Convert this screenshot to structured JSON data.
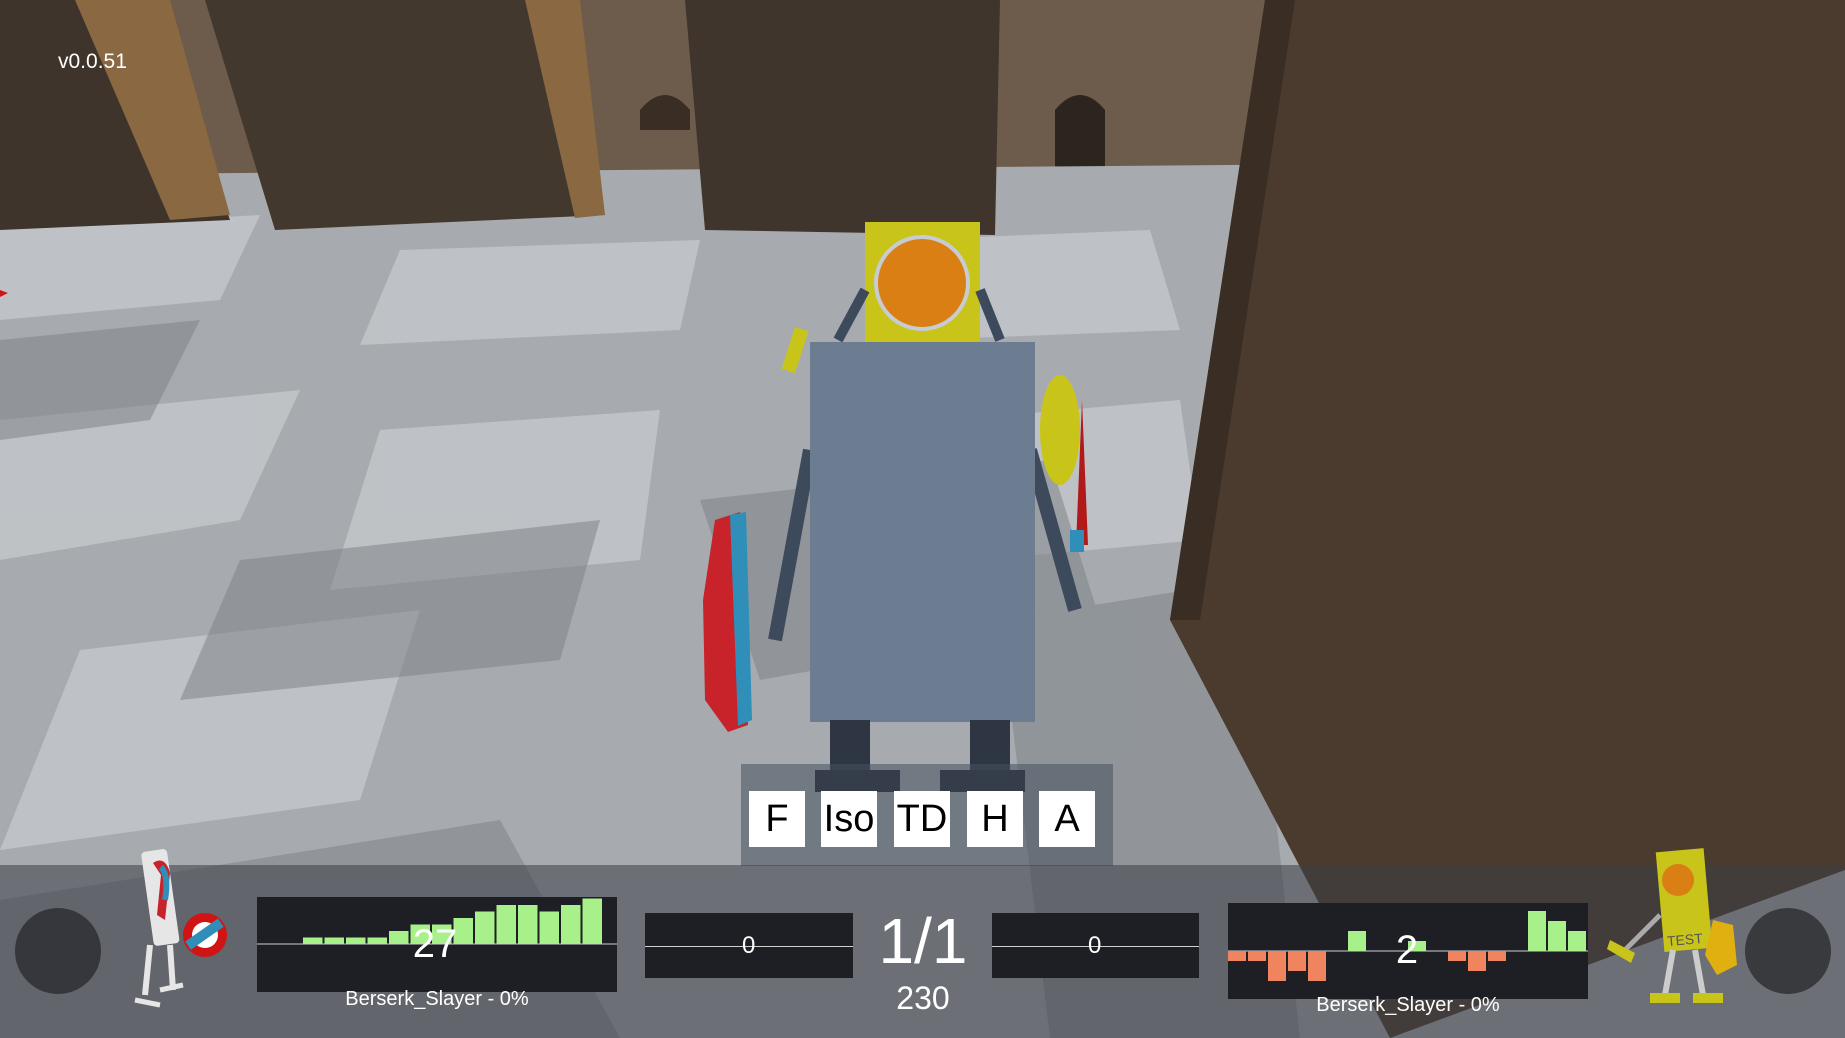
{
  "version": "v0.0.51",
  "camera_buttons": [
    "F",
    "Iso",
    "TD",
    "H",
    "A"
  ],
  "round": "1/1",
  "timer": "230",
  "left_player": {
    "name_label": "Berserk_Slayer - 0%",
    "score": "27",
    "graph_values": [
      0,
      0,
      1,
      1,
      1,
      1,
      2,
      3,
      3,
      4,
      5,
      6,
      6,
      5,
      6,
      7
    ]
  },
  "right_player": {
    "name_label": "Berserk_Slayer - 0%",
    "score": "2",
    "graph_values": [
      -1,
      -1,
      -3,
      -2,
      -3,
      0,
      2,
      0,
      0,
      1,
      0,
      -1,
      -2,
      -1,
      0,
      4,
      3,
      2
    ]
  },
  "left_mid_value": "0",
  "right_mid_value": "0",
  "colors": {
    "graph_positive": "#a8f08a",
    "graph_negative": "#f0845e",
    "robot_yellow": "#c8c41a",
    "robot_body": "#6c7d92",
    "shield_red": "#c8232a",
    "shield_blue": "#2f8fb8",
    "helmet_orange": "#d97f14"
  },
  "icons": {
    "left_avatar": "robot-red-blue-icon",
    "right_avatar": "robot-yellow-test-icon",
    "joystick": "joystick-icon"
  }
}
